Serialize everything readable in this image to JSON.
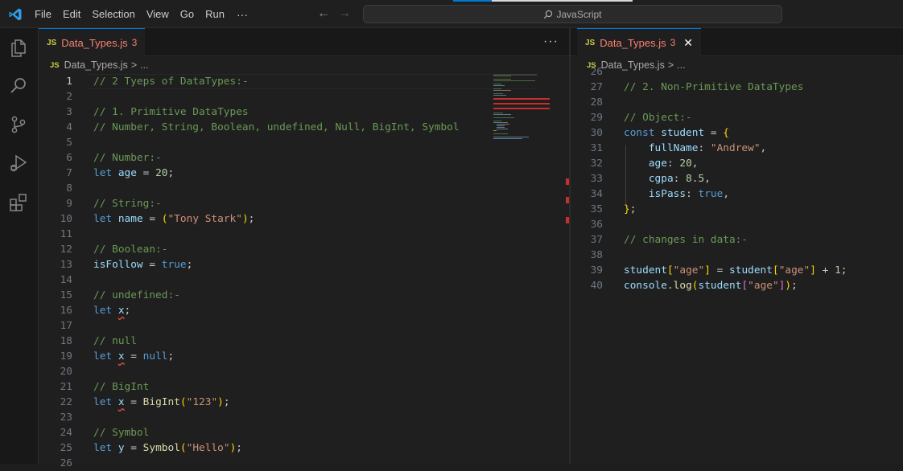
{
  "titlebar": {
    "menu": [
      "File",
      "Edit",
      "Selection",
      "View",
      "Go",
      "Run"
    ],
    "more": "···",
    "search": "JavaScript"
  },
  "colors": {
    "accent": "#0078d4",
    "error": "#f88070",
    "js_badge": "#cbcb41"
  },
  "activity_icons": [
    "explorer-icon",
    "search-icon",
    "source-control-icon",
    "run-debug-icon",
    "extensions-icon"
  ],
  "editor_left": {
    "tab": {
      "badge": "JS",
      "label": "Data_Types.js",
      "problems": "3"
    },
    "more": "···",
    "breadcrumb": {
      "badge": "JS",
      "file": "Data_Types.js",
      "sep": ">",
      "rest": "..."
    },
    "lines": [
      {
        "n": "1",
        "tokens": [
          [
            "c",
            "// 2 Tyeps of DataTypes:-"
          ]
        ]
      },
      {
        "n": "2",
        "tokens": []
      },
      {
        "n": "3",
        "tokens": [
          [
            "c",
            "// 1. Primitive DataTypes"
          ]
        ]
      },
      {
        "n": "4",
        "tokens": [
          [
            "c",
            "// Number, String, Boolean, undefined, Null, BigInt, Symbol"
          ]
        ]
      },
      {
        "n": "5",
        "tokens": []
      },
      {
        "n": "6",
        "tokens": [
          [
            "c",
            "// Number:-"
          ]
        ]
      },
      {
        "n": "7",
        "tokens": [
          [
            "k",
            "let "
          ],
          [
            "v",
            "age"
          ],
          [
            "p",
            " = "
          ],
          [
            "n",
            "20"
          ],
          [
            "p",
            ";"
          ]
        ]
      },
      {
        "n": "8",
        "tokens": []
      },
      {
        "n": "9",
        "tokens": [
          [
            "c",
            "// String:-"
          ]
        ]
      },
      {
        "n": "10",
        "tokens": [
          [
            "k",
            "let "
          ],
          [
            "v",
            "name"
          ],
          [
            "p",
            " = "
          ],
          [
            "br",
            "("
          ],
          [
            "s",
            "\"Tony Stark\""
          ],
          [
            "br",
            ")"
          ],
          [
            "p",
            ";"
          ]
        ]
      },
      {
        "n": "11",
        "tokens": []
      },
      {
        "n": "12",
        "tokens": [
          [
            "c",
            "// Boolean:-"
          ]
        ]
      },
      {
        "n": "13",
        "tokens": [
          [
            "v",
            "isFollow"
          ],
          [
            "p",
            " = "
          ],
          [
            "k",
            "true"
          ],
          [
            "p",
            ";"
          ]
        ]
      },
      {
        "n": "14",
        "tokens": []
      },
      {
        "n": "15",
        "tokens": [
          [
            "c",
            "// undefined:-"
          ]
        ]
      },
      {
        "n": "16",
        "tokens": [
          [
            "k",
            "let "
          ],
          [
            "v squig",
            "x"
          ],
          [
            "p",
            ";"
          ]
        ]
      },
      {
        "n": "17",
        "tokens": []
      },
      {
        "n": "18",
        "tokens": [
          [
            "c",
            "// null"
          ]
        ]
      },
      {
        "n": "19",
        "tokens": [
          [
            "k",
            "let "
          ],
          [
            "v squig",
            "x"
          ],
          [
            "p",
            " = "
          ],
          [
            "k",
            "null"
          ],
          [
            "p",
            ";"
          ]
        ]
      },
      {
        "n": "20",
        "tokens": []
      },
      {
        "n": "21",
        "tokens": [
          [
            "c",
            "// BigInt"
          ]
        ]
      },
      {
        "n": "22",
        "tokens": [
          [
            "k",
            "let "
          ],
          [
            "v squig",
            "x"
          ],
          [
            "p",
            " = "
          ],
          [
            "f",
            "BigInt"
          ],
          [
            "br",
            "("
          ],
          [
            "s",
            "\"123\""
          ],
          [
            "br",
            ")"
          ],
          [
            "p",
            ";"
          ]
        ]
      },
      {
        "n": "23",
        "tokens": []
      },
      {
        "n": "24",
        "tokens": [
          [
            "c",
            "// Symbol"
          ]
        ]
      },
      {
        "n": "25",
        "tokens": [
          [
            "k",
            "let "
          ],
          [
            "v",
            "y"
          ],
          [
            "p",
            " = "
          ],
          [
            "f",
            "Symbol"
          ],
          [
            "br",
            "("
          ],
          [
            "s",
            "\"Hello\""
          ],
          [
            "br",
            ")"
          ],
          [
            "p",
            ";"
          ]
        ]
      },
      {
        "n": "26",
        "tokens": []
      }
    ]
  },
  "editor_right": {
    "tab": {
      "badge": "JS",
      "label": "Data_Types.js",
      "problems": "3",
      "close": "✕"
    },
    "breadcrumb": {
      "badge": "JS",
      "file": "Data_Types.js",
      "sep": ">",
      "rest": "..."
    },
    "lines": [
      {
        "n": "26",
        "tokens": []
      },
      {
        "n": "27",
        "tokens": [
          [
            "c",
            "// 2. Non-Primitive DataTypes"
          ]
        ]
      },
      {
        "n": "28",
        "tokens": []
      },
      {
        "n": "29",
        "tokens": [
          [
            "c",
            "// Object:-"
          ]
        ]
      },
      {
        "n": "30",
        "tokens": [
          [
            "k",
            "const "
          ],
          [
            "v",
            "student"
          ],
          [
            "p",
            " = "
          ],
          [
            "br",
            "{"
          ]
        ]
      },
      {
        "n": "31",
        "tokens": [
          [
            "p",
            "    "
          ],
          [
            "v",
            "fullName"
          ],
          [
            "p",
            ": "
          ],
          [
            "s",
            "\"Andrew\""
          ],
          [
            "p",
            ","
          ]
        ]
      },
      {
        "n": "32",
        "tokens": [
          [
            "p",
            "    "
          ],
          [
            "v",
            "age"
          ],
          [
            "p",
            ": "
          ],
          [
            "n",
            "20"
          ],
          [
            "p",
            ","
          ]
        ]
      },
      {
        "n": "33",
        "tokens": [
          [
            "p",
            "    "
          ],
          [
            "v",
            "cgpa"
          ],
          [
            "p",
            ": "
          ],
          [
            "n",
            "8.5"
          ],
          [
            "p",
            ","
          ]
        ]
      },
      {
        "n": "34",
        "tokens": [
          [
            "p",
            "    "
          ],
          [
            "v",
            "isPass"
          ],
          [
            "p",
            ": "
          ],
          [
            "k",
            "true"
          ],
          [
            "p",
            ","
          ]
        ]
      },
      {
        "n": "35",
        "tokens": [
          [
            "br",
            "}"
          ],
          [
            "p",
            ";"
          ]
        ]
      },
      {
        "n": "36",
        "tokens": []
      },
      {
        "n": "37",
        "tokens": [
          [
            "c",
            "// changes in data:-"
          ]
        ]
      },
      {
        "n": "38",
        "tokens": []
      },
      {
        "n": "39",
        "tokens": [
          [
            "v",
            "student"
          ],
          [
            "br",
            "["
          ],
          [
            "s",
            "\"age\""
          ],
          [
            "br",
            "]"
          ],
          [
            "p",
            " = "
          ],
          [
            "v",
            "student"
          ],
          [
            "br",
            "["
          ],
          [
            "s",
            "\"age\""
          ],
          [
            "br",
            "]"
          ],
          [
            "p",
            " + "
          ],
          [
            "n",
            "1"
          ],
          [
            "p",
            ";"
          ]
        ]
      },
      {
        "n": "40",
        "tokens": [
          [
            "v",
            "console"
          ],
          [
            "p",
            "."
          ],
          [
            "f",
            "log"
          ],
          [
            "br",
            "("
          ],
          [
            "v",
            "student"
          ],
          [
            "br2",
            "["
          ],
          [
            "s",
            "\"age\""
          ],
          [
            "br2",
            "]"
          ],
          [
            "br",
            ")"
          ],
          [
            "p",
            ";"
          ]
        ]
      }
    ]
  }
}
